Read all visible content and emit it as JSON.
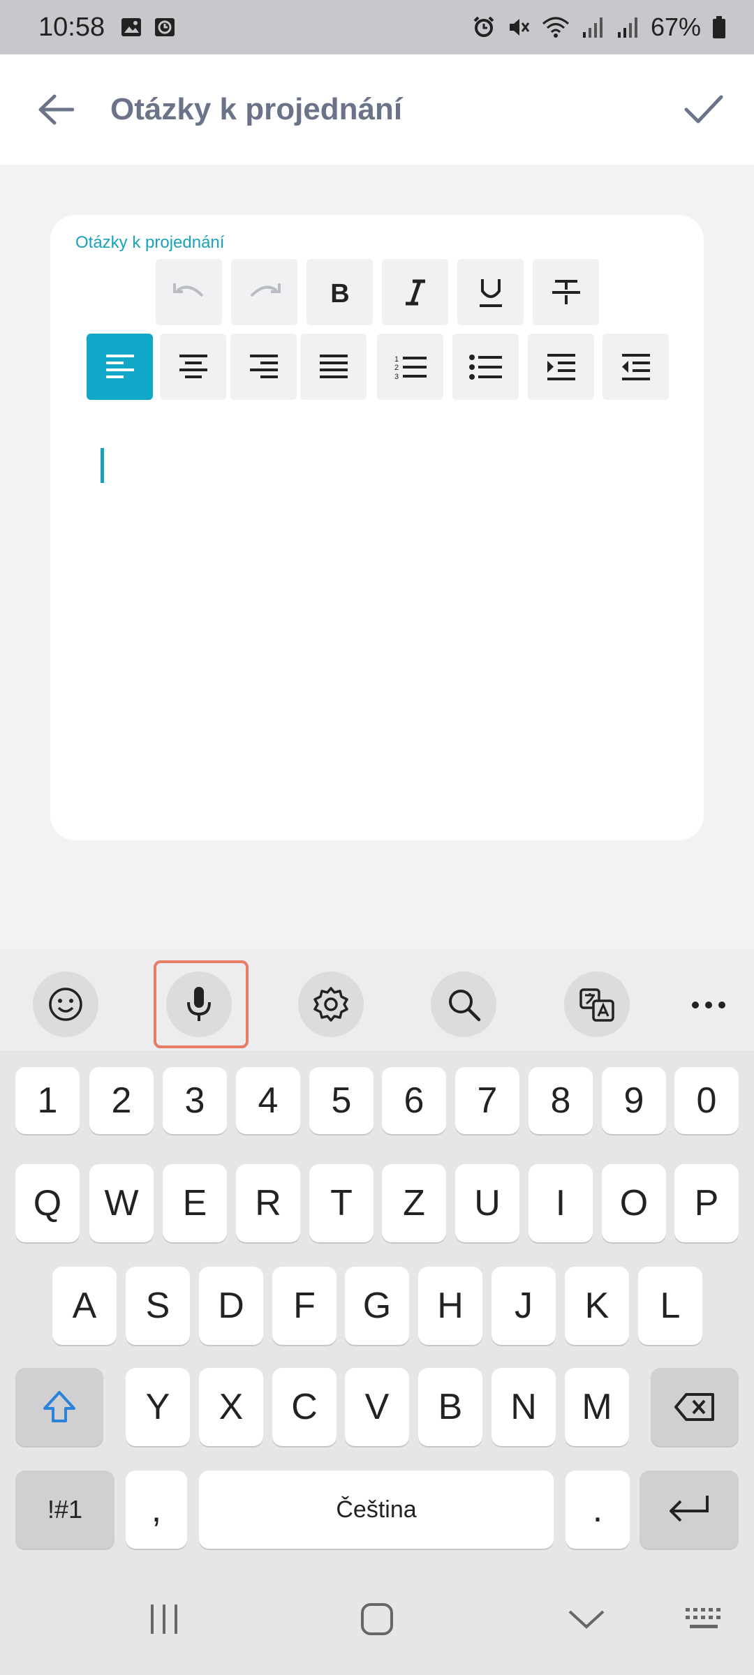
{
  "status": {
    "time": "10:58",
    "battery": "67%"
  },
  "appbar": {
    "title": "Otázky k projednání"
  },
  "editor": {
    "field_label": "Otázky k projednání",
    "toolbar_row1": [
      "undo-icon",
      "redo-icon",
      "bold-icon",
      "italic-icon",
      "underline-icon",
      "strikethrough-icon"
    ],
    "toolbar_row2": [
      "align-left-icon",
      "align-center-icon",
      "align-right-icon",
      "align-justify-icon",
      "ordered-list-icon",
      "bullet-list-icon",
      "indent-icon",
      "outdent-icon"
    ],
    "active_tool": "align-left-icon",
    "accent": "#11a7c9"
  },
  "keyboard": {
    "toolbar": [
      "emoji-icon",
      "microphone-icon",
      "settings-icon",
      "search-icon",
      "translate-icon",
      "more-icon"
    ],
    "row_numbers": [
      "1",
      "2",
      "3",
      "4",
      "5",
      "6",
      "7",
      "8",
      "9",
      "0"
    ],
    "row_q": [
      "Q",
      "W",
      "E",
      "R",
      "T",
      "Z",
      "U",
      "I",
      "O",
      "P"
    ],
    "row_a": [
      "A",
      "S",
      "D",
      "F",
      "G",
      "H",
      "J",
      "K",
      "L"
    ],
    "row_y": [
      "Y",
      "X",
      "C",
      "V",
      "B",
      "N",
      "M"
    ],
    "symbols": "!#1",
    "comma": ",",
    "space": "Čeština",
    "period": "."
  }
}
